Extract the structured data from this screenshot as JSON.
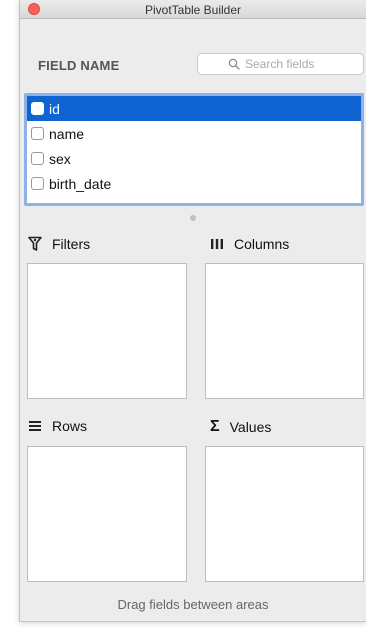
{
  "window": {
    "title": "PivotTable Builder"
  },
  "fields": {
    "header": "FIELD NAME",
    "search_placeholder": "Search fields",
    "items": [
      {
        "label": "id",
        "selected": true,
        "checked": false
      },
      {
        "label": "name",
        "selected": false,
        "checked": false
      },
      {
        "label": "sex",
        "selected": false,
        "checked": false
      },
      {
        "label": "birth_date",
        "selected": false,
        "checked": false
      }
    ]
  },
  "areas": {
    "filters": {
      "label": "Filters",
      "icon": "filter-funnel-icon"
    },
    "columns": {
      "label": "Columns",
      "icon": "columns-icon"
    },
    "rows": {
      "label": "Rows",
      "icon": "rows-icon"
    },
    "values": {
      "label": "Values",
      "icon": "sigma-icon",
      "glyph": "Σ"
    }
  },
  "footer": {
    "hint": "Drag fields between areas"
  },
  "colors": {
    "selection": "#0f64d2",
    "list_focus_ring": "#8db3e6",
    "close_button": "#fc5f57"
  }
}
